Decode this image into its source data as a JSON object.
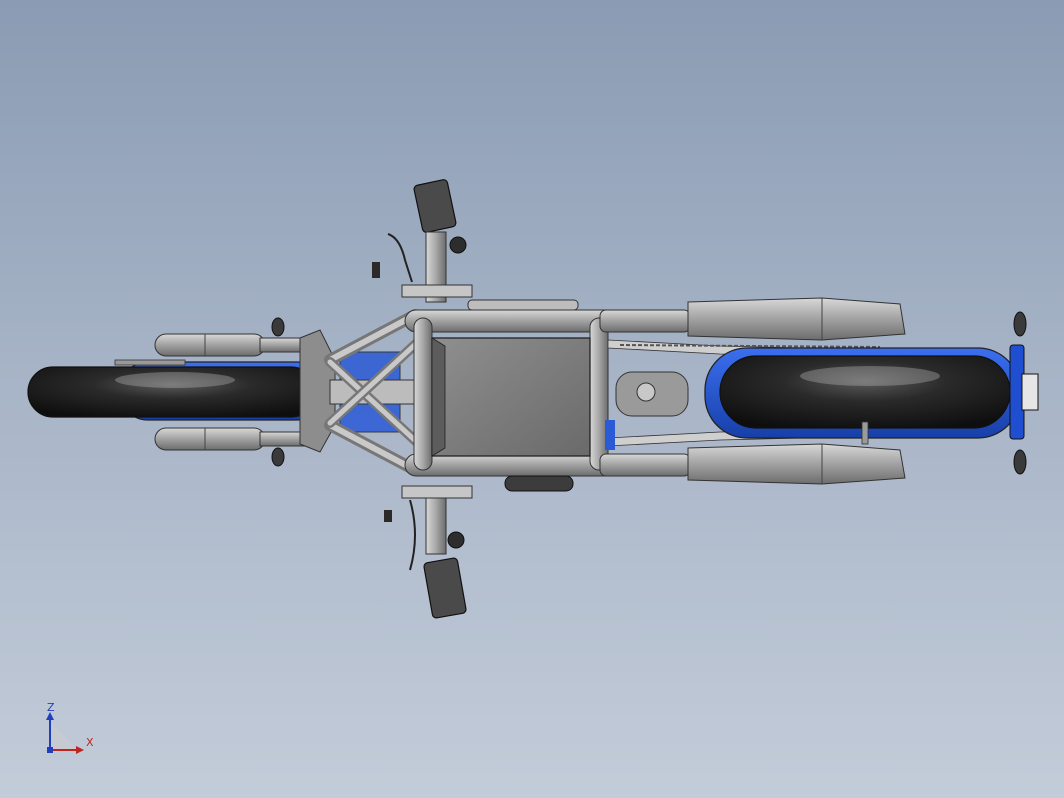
{
  "colors": {
    "background_top": "#8a9bb3",
    "background_bottom": "#c3ccd9",
    "metal": "#a9a9a9",
    "metal_dark": "#6f6f6f",
    "tire": "#1c1c1c",
    "accent_blue": "#1f4fd0",
    "outline": "#2b2b2b"
  },
  "model": {
    "subject": "motorcycle-top-view"
  },
  "triad": {
    "z_label": "Z",
    "x_label": "X",
    "z_color": "#1f3fbf",
    "x_color": "#c0241e"
  }
}
